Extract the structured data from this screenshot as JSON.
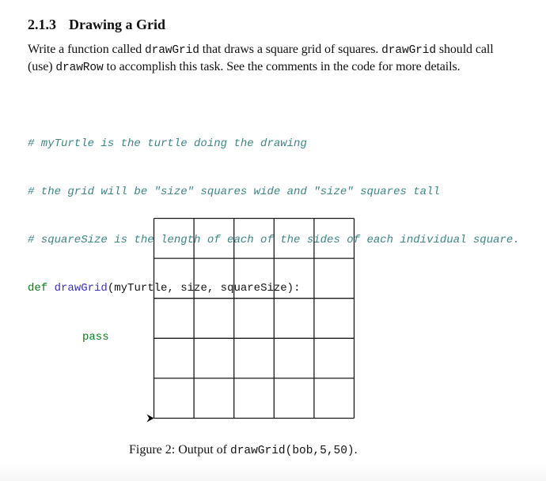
{
  "section": {
    "number": "2.1.3",
    "title": "Drawing a Grid"
  },
  "paragraph": {
    "parts": [
      {
        "text": "Write a function called ",
        "mono": false
      },
      {
        "text": "drawGrid",
        "mono": true
      },
      {
        "text": " that draws a square grid of squares. ",
        "mono": false
      },
      {
        "text": "drawGrid",
        "mono": true
      },
      {
        "text": " should call (use) ",
        "mono": false
      },
      {
        "text": "drawRow",
        "mono": true
      },
      {
        "text": " to accomplish this task. See the comments in the code for more details.",
        "mono": false
      }
    ],
    "p0": "Write a function called ",
    "p1": "drawGrid",
    "p2": " that draws a square grid of squares. ",
    "p3": "drawGrid",
    "p4": " should call (use) ",
    "p5": "drawRow",
    "p6": " to accomplish this task. See the comments in the code for more details."
  },
  "code": {
    "comment1": "# myTurtle is the turtle doing the drawing",
    "comment2": "# the grid will be \"size\" squares wide and \"size\" squares tall",
    "comment3": "# squareSize is the length of each of the sides of each individual square.",
    "def_keyword": "def",
    "function_name": "drawGrid",
    "params": "(myTurtle, size, squareSize):",
    "body": "pass"
  },
  "figure": {
    "grid_rows": 5,
    "grid_cols": 5,
    "line_color": "#1a1a1a",
    "turtle_color": "#000000",
    "caption_prefix": "Figure 2: Output of ",
    "caption_code": "drawGrid(bob,5,50)",
    "caption_suffix": "."
  },
  "colors": {
    "comment": "#3f8585",
    "keyword": "#0a7a1a",
    "function": "#3b2fc9"
  }
}
